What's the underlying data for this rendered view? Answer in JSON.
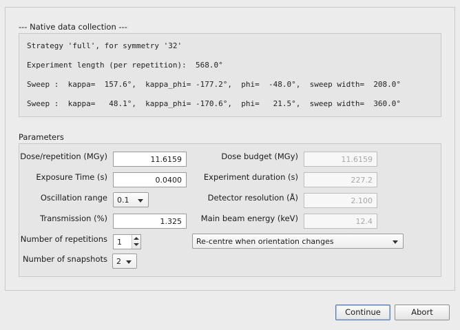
{
  "summary": {
    "title": "--- Native data collection ---",
    "lines": [
      "Strategy 'full', for symmetry '32'",
      "Experiment length (per repetition):  568.0°",
      "Sweep :  kappa=  157.6°,  kappa_phi= -177.2°,  phi=  -48.0°,  sweep width=  208.0°",
      "Sweep :  kappa=   48.1°,  kappa_phi= -170.6°,  phi=   21.5°,  sweep width=  360.0°"
    ]
  },
  "parameters": {
    "title": "Parameters",
    "dose_label": "Dose/repetition (MGy)",
    "dose_value": "11.6159",
    "dose_budget_label": "Dose budget (MGy)",
    "dose_budget_value": "11.6159",
    "exposure_label": "Exposure Time (s)",
    "exposure_value": "0.0400",
    "duration_label": "Experiment duration (s)",
    "duration_value": "227.2",
    "oscillation_label": "Oscillation range",
    "oscillation_value": "0.1",
    "resolution_label": "Detector resolution (Å)",
    "resolution_value": "2.100",
    "transmission_label": "Transmission (%)",
    "transmission_value": "1.325",
    "energy_label": "Main beam energy (keV)",
    "energy_value": "12.4",
    "repetitions_label": "Number of repetitions",
    "repetitions_value": "1",
    "recentre_value": "Re-centre when orientation changes",
    "snapshots_label": "Number of snapshots",
    "snapshots_value": "2"
  },
  "buttons": {
    "continue": "Continue",
    "abort": "Abort"
  }
}
